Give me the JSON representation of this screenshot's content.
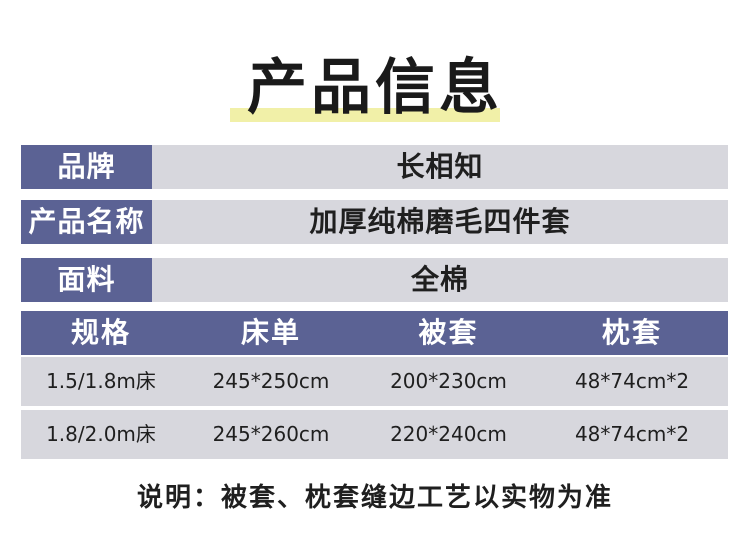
{
  "title": "产品信息",
  "info": [
    {
      "label": "品牌",
      "value": "长相知"
    },
    {
      "label": "产品名称",
      "value": "加厚纯棉磨毛四件套"
    },
    {
      "label": "面料",
      "value": "全棉"
    }
  ],
  "spec_table": {
    "headers": [
      "规格",
      "床单",
      "被套",
      "枕套"
    ],
    "rows": [
      [
        "1.5/1.8m床",
        "245*250cm",
        "200*230cm",
        "48*74cm*2"
      ],
      [
        "1.8/2.0m床",
        "245*260cm",
        "220*240cm",
        "48*74cm*2"
      ]
    ]
  },
  "note": "说明：被套、枕套缝边工艺以实物为准",
  "colors": {
    "label_bg": "#5b6294",
    "row_bg": "#d7d7dd",
    "title_highlight": "#f1f0a8"
  }
}
